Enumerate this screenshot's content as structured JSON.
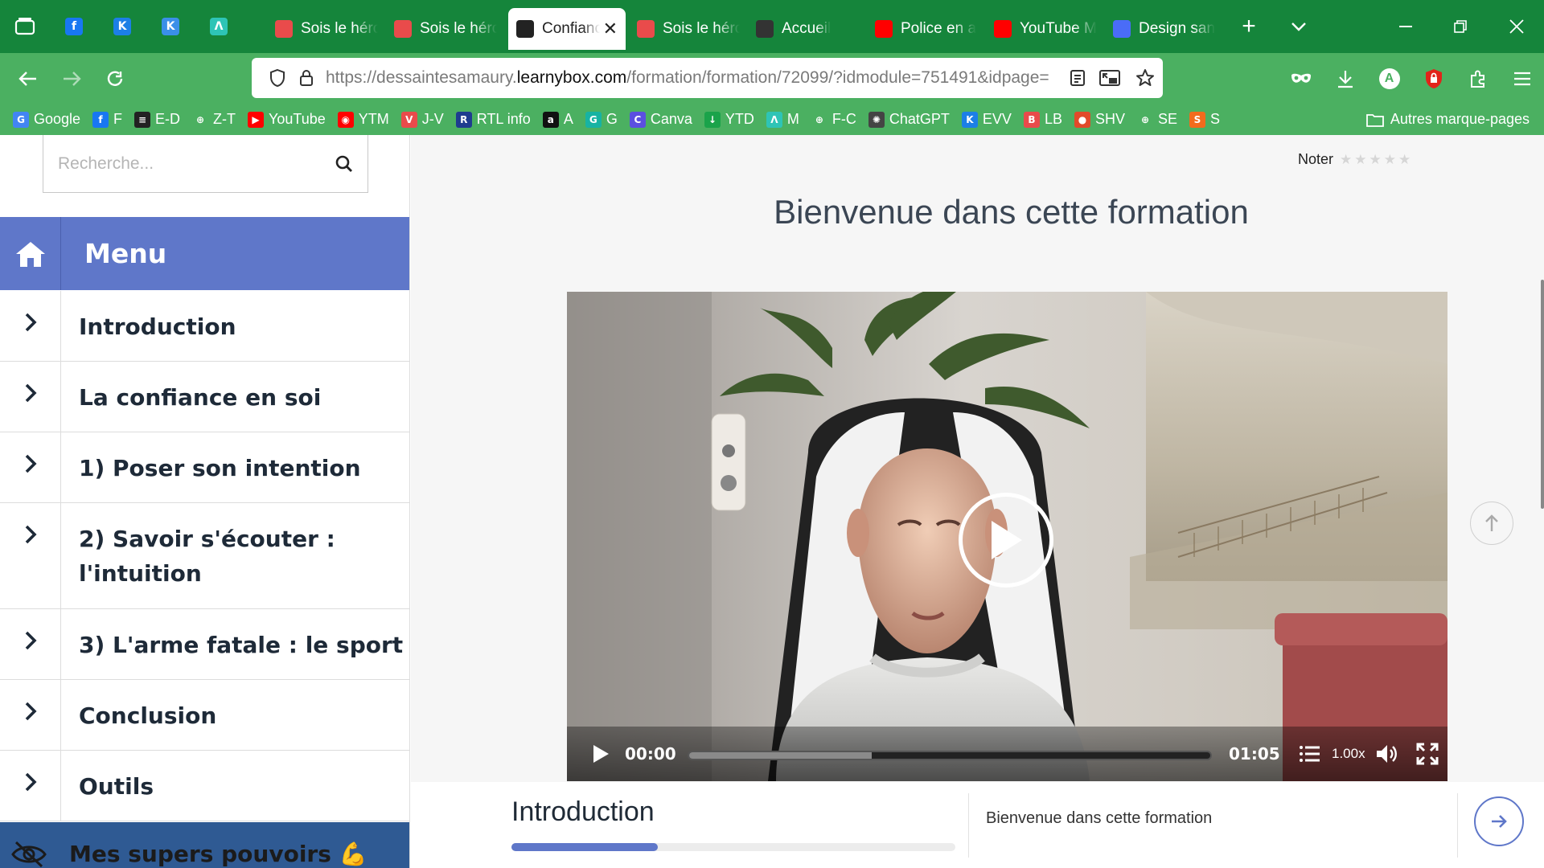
{
  "browser": {
    "pinned_tabs": [
      {
        "icon": "facebook-icon",
        "glyph": "f",
        "color": "#1877f2"
      },
      {
        "icon": "k-app-icon",
        "glyph": "K",
        "color": "#1c7fe6"
      },
      {
        "icon": "k-app-icon",
        "glyph": "K",
        "color": "#3a8fe8"
      },
      {
        "icon": "m-app-icon",
        "glyph": "Λ",
        "color": "#2ec4b6"
      }
    ],
    "tabs": [
      {
        "title": "Sois le héros",
        "icon": "bookmark-red-icon",
        "color": "#e94b4b",
        "active": false
      },
      {
        "title": "Sois le héros",
        "icon": "bookmark-red-icon",
        "color": "#e94b4b",
        "active": false
      },
      {
        "title": "Confiance",
        "icon": "site-dark-icon",
        "color": "#222",
        "active": true
      },
      {
        "title": "Sois le héros",
        "icon": "bookmark-red-icon",
        "color": "#e94b4b",
        "active": false
      },
      {
        "title": "Accueil",
        "icon": "site-dark-icon",
        "color": "#333",
        "active": false
      },
      {
        "title": "Police en a",
        "icon": "youtube-icon",
        "color": "#ff0000",
        "active": false
      },
      {
        "title": "YouTube M",
        "icon": "youtube-music-icon",
        "color": "#ff0000",
        "active": false
      },
      {
        "title": "Design san",
        "icon": "calendar-icon",
        "color": "#4a6cf7",
        "active": false
      }
    ],
    "url_prefix": "https://dessaintesamaury.",
    "url_domain": "learnybox.com",
    "url_path": "/formation/formation/72099/?idmodule=751491&idpage=",
    "bookmarks": [
      {
        "label": "Google",
        "icon": "google-icon",
        "glyph": "G",
        "color": "#4285f4"
      },
      {
        "label": "F",
        "icon": "facebook-icon",
        "glyph": "f",
        "color": "#1877f2"
      },
      {
        "label": "E-D",
        "icon": "ed-icon",
        "glyph": "≡",
        "color": "#222"
      },
      {
        "label": "Z-T",
        "icon": "globe-icon",
        "glyph": "⊕",
        "color": "transparent"
      },
      {
        "label": "YouTube",
        "icon": "youtube-icon",
        "glyph": "▶",
        "color": "#ff0000"
      },
      {
        "label": "YTM",
        "icon": "youtube-music-icon",
        "glyph": "◉",
        "color": "#ff0000"
      },
      {
        "label": "J-V",
        "icon": "jv-icon",
        "glyph": "V",
        "color": "#e94b4b"
      },
      {
        "label": "RTL info",
        "icon": "rtl-icon",
        "glyph": "R",
        "color": "#1e3c8f"
      },
      {
        "label": "A",
        "icon": "amazon-icon",
        "glyph": "a",
        "color": "#111"
      },
      {
        "label": "G",
        "icon": "g-app-icon",
        "glyph": "G",
        "color": "#17b3a3"
      },
      {
        "label": "Canva",
        "icon": "canva-icon",
        "glyph": "C",
        "color": "#5b4fe0"
      },
      {
        "label": "YTD",
        "icon": "download-icon",
        "glyph": "↓",
        "color": "#1aa34a"
      },
      {
        "label": "M",
        "icon": "m-app-icon",
        "glyph": "Λ",
        "color": "#2ec4b6"
      },
      {
        "label": "F-C",
        "icon": "globe-icon",
        "glyph": "⊕",
        "color": "transparent"
      },
      {
        "label": "ChatGPT",
        "icon": "chatgpt-icon",
        "glyph": "✺",
        "color": "#444"
      },
      {
        "label": "EVV",
        "icon": "k-app-icon",
        "glyph": "K",
        "color": "#1c7fe6"
      },
      {
        "label": "LB",
        "icon": "bookmark-red-icon",
        "glyph": "B",
        "color": "#e94b4b"
      },
      {
        "label": "SHV",
        "icon": "shv-icon",
        "glyph": "●",
        "color": "#e14a2a"
      },
      {
        "label": "SE",
        "icon": "globe-icon",
        "glyph": "⊕",
        "color": "transparent"
      },
      {
        "label": "S",
        "icon": "s-app-icon",
        "glyph": "S",
        "color": "#f26b1d"
      }
    ],
    "other_bookmarks": "Autres marque-pages",
    "profile_initial": "A"
  },
  "sidebar": {
    "search_placeholder": "Recherche...",
    "menu_label": "Menu",
    "items": [
      {
        "label": "Introduction"
      },
      {
        "label": "La confiance en soi"
      },
      {
        "label": "1) Poser son intention"
      },
      {
        "label": "2) Savoir s'écouter : l'intuition"
      },
      {
        "label": "3) L'arme fatale : le sport"
      },
      {
        "label": "Conclusion"
      },
      {
        "label": "Outils"
      }
    ],
    "powers_label": "Mes supers pouvoirs 💪"
  },
  "main": {
    "rating_label": "Noter",
    "stars": 5,
    "title": "Bienvenue dans cette formation",
    "video": {
      "current_time": "00:00",
      "duration": "01:05",
      "speed": "1.00x",
      "buffered_fraction": 0.35
    },
    "bottom": {
      "lesson": "Introduction",
      "progress_fraction": 0.33,
      "next_title": "Bienvenue dans cette formation"
    }
  },
  "colors": {
    "browser_green_dark": "#15853b",
    "browser_green": "#4bb061",
    "accent": "#5f77c9",
    "powers_bg": "#2f5a93"
  }
}
